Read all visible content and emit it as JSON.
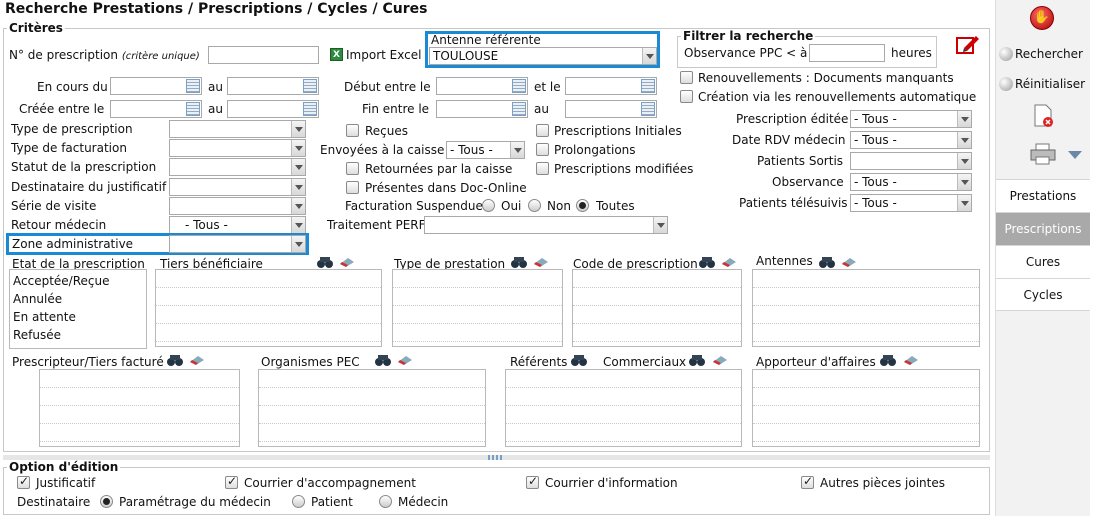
{
  "page_title": "Recherche Prestations / Prescriptions / Cycles / Cures",
  "criteres": {
    "legend": "Critères",
    "no_prescription": "N° de prescription",
    "critere_unique": "(critère unique)",
    "import_excel": "Import Excel",
    "antenne_referente": "Antenne référente",
    "antenne_value": "TOULOUSE",
    "en_cours_du": "En cours du",
    "creee_entre": "Créée entre le",
    "au": "au",
    "debut_entre": "Début entre le",
    "fin_entre": "Fin entre le",
    "et_le": "et le",
    "type_prescription": "Type de prescription",
    "type_facturation": "Type de facturation",
    "statut": "Statut de la prescription",
    "destinataire_justif": "Destinataire du justificatif",
    "serie_visite": "Série de visite",
    "retour_medecin": "Retour médecin",
    "retour_medecin_value": "- Tous -",
    "zone_admin": "Zone administrative",
    "recues": "Reçues",
    "envoyees_caisse": "Envoyées à la caisse",
    "envoyees_value": "- Tous -",
    "retournees": "Retournées par la caisse",
    "presentes": "Présentes dans Doc-Online",
    "fact_suspendue": "Facturation Suspendue",
    "oui": "Oui",
    "non": "Non",
    "toutes": "Toutes",
    "traitement_perf": "Traitement PERF",
    "presc_initiales": "Prescriptions Initiales",
    "prolongations": "Prolongations",
    "presc_modifiees": "Prescriptions modifiées"
  },
  "filtrer": {
    "legend": "Filtrer la recherche",
    "observance_ppc": "Observance PPC < à",
    "heures": "heures"
  },
  "right_fields": {
    "renouvellements": "Renouvellements : Documents manquants",
    "creation_renouv": "Création via les renouvellements automatique",
    "presc_editee": "Prescription éditée",
    "presc_editee_value": "- Tous -",
    "date_rdv": "Date RDV médecin",
    "date_rdv_value": "- Tous -",
    "patients_sortis": "Patients Sortis",
    "observance": "Observance",
    "observance_value": "- Tous -",
    "telesuivis": "Patients télésuivis",
    "telesuivis_value": "- Tous -"
  },
  "lists": {
    "etat": "Etat de la prescription",
    "etat_items": [
      "Acceptée/Reçue",
      "Annulée",
      "En attente",
      "Refusée"
    ],
    "tiers": "Tiers bénéficiaire",
    "type_prestation": "Type de prestation",
    "code_prescription": "Code de prescription",
    "antennes": "Antennes",
    "prescripteur": "Prescripteur/Tiers facturé",
    "organismes": "Organismes PEC",
    "referents": "Référents",
    "commerciaux": "Commerciaux",
    "apporteur": "Apporteur d'affaires"
  },
  "options": {
    "legend": "Option d'édition",
    "justificatif": "Justificatif",
    "courrier_acc": "Courrier d'accompagnement",
    "courrier_info": "Courrier d'information",
    "autres_pieces": "Autres pièces jointes",
    "destinataire": "Destinataire",
    "param_medecin": "Paramétrage du médecin",
    "patient": "Patient",
    "medecin": "Médecin"
  },
  "sidebar": {
    "rechercher": "Rechercher",
    "reinitialiser": "Réinitialiser",
    "tabs": [
      "Prestations",
      "Prescriptions",
      "Cures",
      "Cycles"
    ]
  }
}
